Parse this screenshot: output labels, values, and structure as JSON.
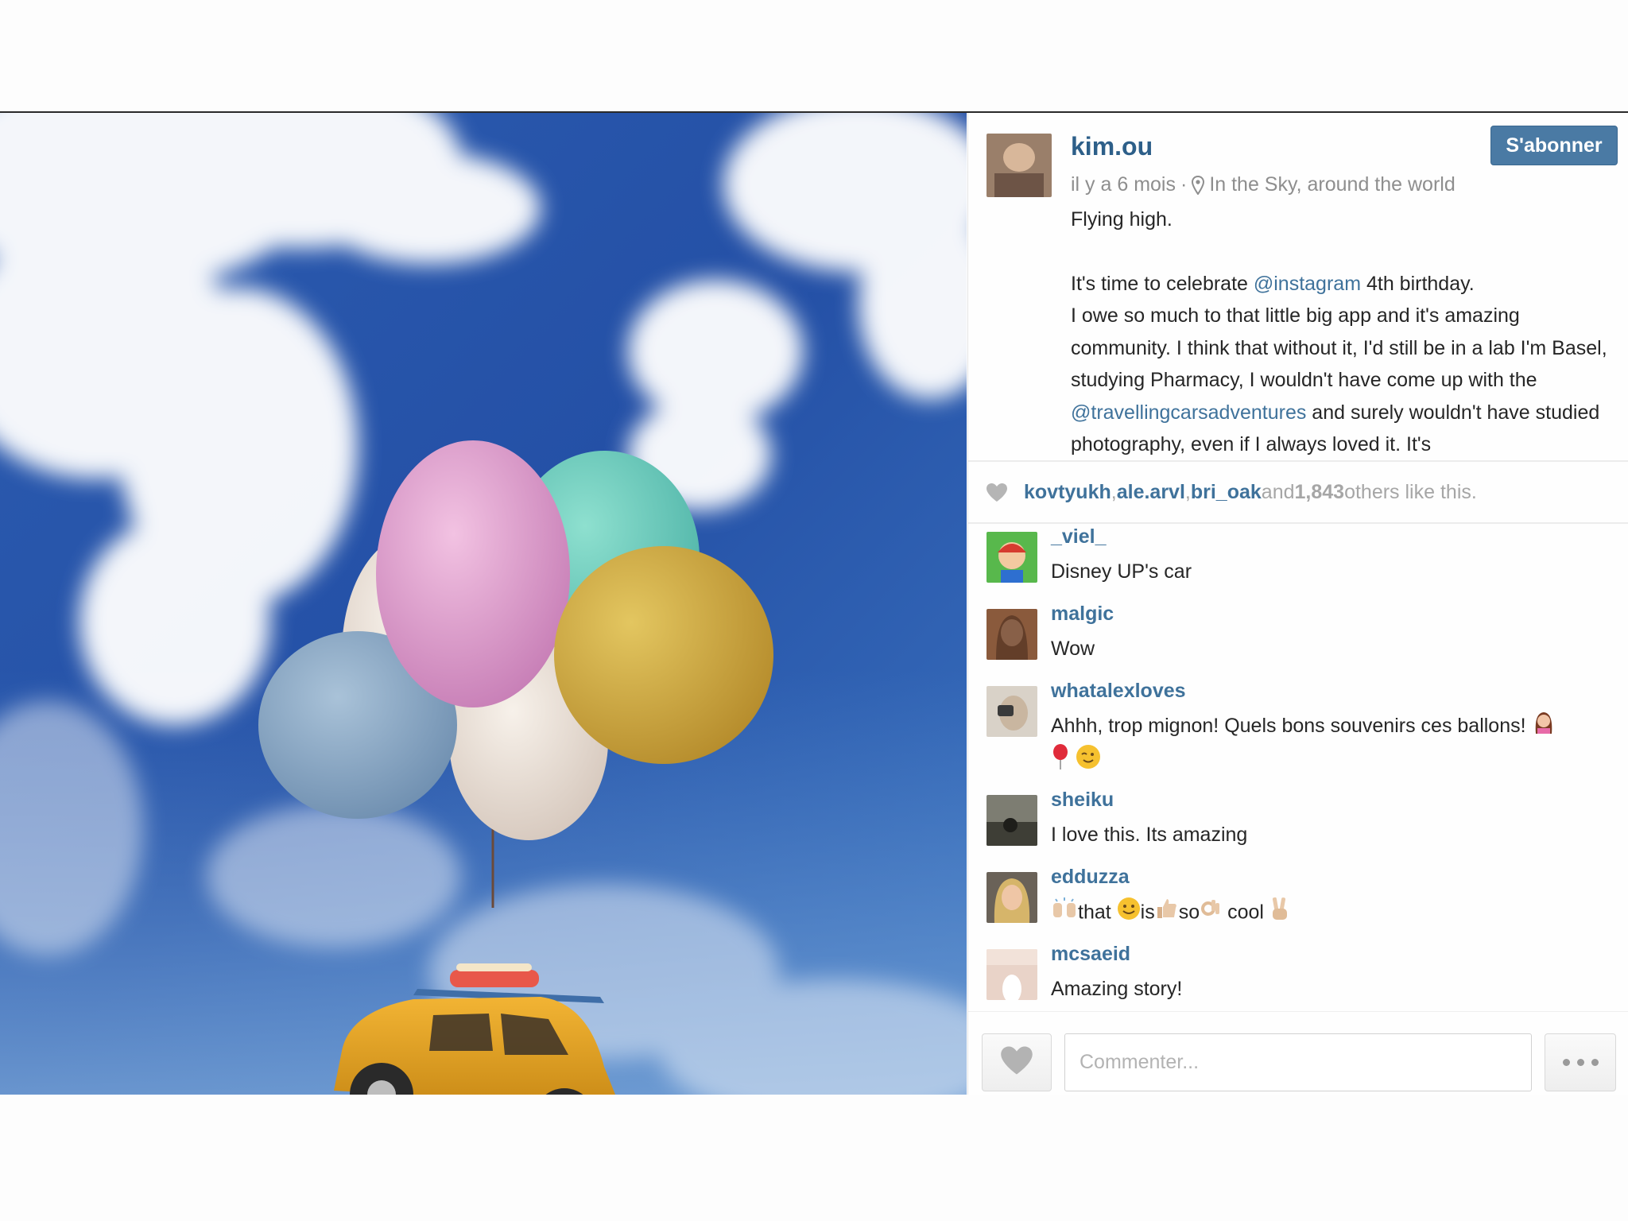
{
  "post": {
    "username": "kim.ou",
    "follow_label": "S'abonner",
    "time_ago": "il y a 6 mois",
    "separator": "·",
    "location": "In the Sky, around the world",
    "caption": {
      "line1": "Flying high.",
      "p2_before": "It's time to celebrate ",
      "p2_mention": "@instagram",
      "p2_after": " 4th birthday.",
      "p3_before": "I owe so much to that little big app and it's amazing community. I think that without it, I'd still be in a lab I'm Basel, studying Pharmacy, I wouldn't have come up with the ",
      "p3_mention": "@travellingcarsadventures",
      "p3_after": " and surely wouldn't have studied photography, even if I always loved it. It's"
    }
  },
  "likes": {
    "likers": [
      "kovtyukh",
      "ale.arvl",
      "bri_oak"
    ],
    "comma": ", ",
    "and": " and ",
    "count": "1,843",
    "suffix": " others like this."
  },
  "comments": [
    {
      "user": "_viel_",
      "text": "Disney UP's car"
    },
    {
      "user": "malgic",
      "text": "Wow"
    },
    {
      "user": "whatalexloves",
      "text": "Ahhh, trop mignon! Quels bons souvenirs ces ballons!"
    },
    {
      "user": "sheiku",
      "text": "I love this. Its amazing"
    },
    {
      "user": "edduzza",
      "text_parts": [
        "that",
        "is",
        "so",
        "cool"
      ]
    },
    {
      "user": "mcsaeid",
      "text": "Amazing story!"
    }
  ],
  "footer": {
    "comment_placeholder": "Commenter..."
  },
  "colors": {
    "link": "#3f729b",
    "follow_button": "#4a7aa4",
    "muted_text": "#8e8e8e",
    "sky": "#1e4fa0"
  },
  "icons": [
    "location-pin-icon",
    "heart-icon",
    "more-dots-icon"
  ]
}
